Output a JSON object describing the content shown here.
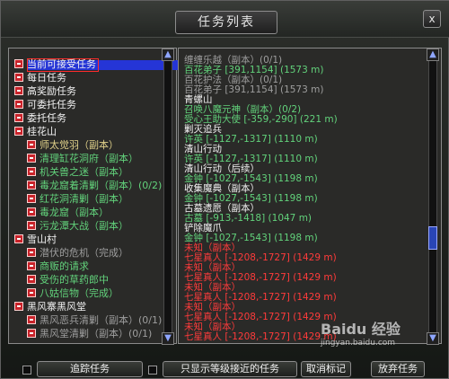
{
  "window": {
    "title": "任务列表",
    "close": "x"
  },
  "colors": {
    "white": "#f2f2f2",
    "green": "#62d27b",
    "red": "#ff3b3b",
    "muted": "#9e9e9e",
    "orange": "#e0d18a"
  },
  "left_list": [
    {
      "label": "当前可接受任务",
      "color": "white",
      "kind": "root",
      "toggle": true
    },
    {
      "label": "每日任务",
      "color": "white",
      "kind": "root",
      "toggle": true
    },
    {
      "label": "高奖励任务",
      "color": "white",
      "kind": "root",
      "toggle": true
    },
    {
      "label": "可委托任务",
      "color": "white",
      "kind": "root",
      "toggle": true
    },
    {
      "label": "委托任务",
      "color": "white",
      "kind": "root",
      "toggle": true
    },
    {
      "label": "桂花山",
      "color": "white",
      "kind": "root",
      "toggle": true
    },
    {
      "label": "师太觉羽（副本）",
      "color": "orange",
      "kind": "child",
      "toggle": true
    },
    {
      "label": "清理缸花洞府（副本）",
      "color": "green",
      "kind": "child",
      "toggle": true
    },
    {
      "label": "机关兽之迷（副本）",
      "color": "green",
      "kind": "child",
      "toggle": true
    },
    {
      "label": "毒龙窟着清剿（副本）(0/2)",
      "color": "green",
      "kind": "child",
      "toggle": true
    },
    {
      "label": "红花洞清剿（副本）",
      "color": "green",
      "kind": "child",
      "toggle": true
    },
    {
      "label": "毒龙窟（副本）",
      "color": "green",
      "kind": "child",
      "toggle": true
    },
    {
      "label": "污龙潭大战（副本）",
      "color": "green",
      "kind": "child",
      "toggle": true
    },
    {
      "label": "雪山村",
      "color": "white",
      "kind": "root",
      "toggle": true
    },
    {
      "label": "潜伏的危机（完成）",
      "color": "muted",
      "kind": "child",
      "toggle": true
    },
    {
      "label": "商贩的请求",
      "color": "green",
      "kind": "child",
      "toggle": true
    },
    {
      "label": "受伤的草药郎中",
      "color": "green",
      "kind": "child",
      "toggle": true
    },
    {
      "label": "八姑信物（完成）",
      "color": "green",
      "kind": "child",
      "toggle": true
    },
    {
      "label": "黑风寨黑风堂",
      "color": "white",
      "kind": "root",
      "toggle": true
    },
    {
      "label": "黑风恶兵清剿（副本）(0/1)",
      "color": "muted",
      "kind": "child",
      "toggle": true
    },
    {
      "label": "黑风堂清剿（副本）(0/1)",
      "color": "muted",
      "kind": "child",
      "toggle": true
    }
  ],
  "right_list": [
    {
      "label": "缠缠乐越（副本）(0/1)",
      "color": "muted"
    },
    {
      "label": "百花弟子 [391,1154] (1573 m)",
      "color": "green"
    },
    {
      "label": "百花护法（副本）(0/1)",
      "color": "muted"
    },
    {
      "label": "百花弟子 [391,1154] (1573 m)",
      "color": "muted"
    },
    {
      "label": "青螺山",
      "color": "white"
    },
    {
      "label": "召唤八魔元神（副本）(0/2)",
      "color": "green"
    },
    {
      "label": "受心王助大使 [-359,-290] (221 m)",
      "color": "green"
    },
    {
      "label": "剿灭追兵",
      "color": "white"
    },
    {
      "label": "许英 [-1127,-1317] (1110 m)",
      "color": "green"
    },
    {
      "label": "清山行动",
      "color": "white"
    },
    {
      "label": "许英 [-1127,-1317] (1110 m)",
      "color": "green"
    },
    {
      "label": "清山行动（后续）",
      "color": "white"
    },
    {
      "label": "金钟 [-1027,-1543] (1198 m)",
      "color": "green"
    },
    {
      "label": "收集魔典（副本）",
      "color": "white"
    },
    {
      "label": "金钟 [-1027,-1543] (1198 m)",
      "color": "green"
    },
    {
      "label": "古墓遗愿（副本）",
      "color": "white"
    },
    {
      "label": "古墓 [-913,-1418] (1047 m)",
      "color": "green"
    },
    {
      "label": "铲除魔爪",
      "color": "white"
    },
    {
      "label": "金钟 [-1027,-1543] (1198 m)",
      "color": "green"
    },
    {
      "label": "未知（副本）",
      "color": "red"
    },
    {
      "label": "七星真人 [-1208,-1727] (1429 m)",
      "color": "red"
    },
    {
      "label": "未知（副本）",
      "color": "red"
    },
    {
      "label": "七星真人 [-1208,-1727] (1429 m)",
      "color": "red"
    },
    {
      "label": "未知（副本）",
      "color": "red"
    },
    {
      "label": "七星真人 [-1208,-1727] (1429 m)",
      "color": "red"
    },
    {
      "label": "未知（副本）",
      "color": "red"
    },
    {
      "label": "七星真人 [-1208,-1727] (1429 m)",
      "color": "red"
    },
    {
      "label": "未知（副本）",
      "color": "red"
    },
    {
      "label": "七星真人 [-1208,-1727] (1429 m)",
      "color": "red"
    }
  ],
  "bottom": {
    "track_label": "追踪任务",
    "only_nearby_label": "只显示等级接近的任务",
    "cancel_label": "取消标记",
    "give_up_label": "放弃任务"
  },
  "watermark": {
    "brand": "Baidu 经验",
    "url": "jingyan.baidu.com"
  }
}
